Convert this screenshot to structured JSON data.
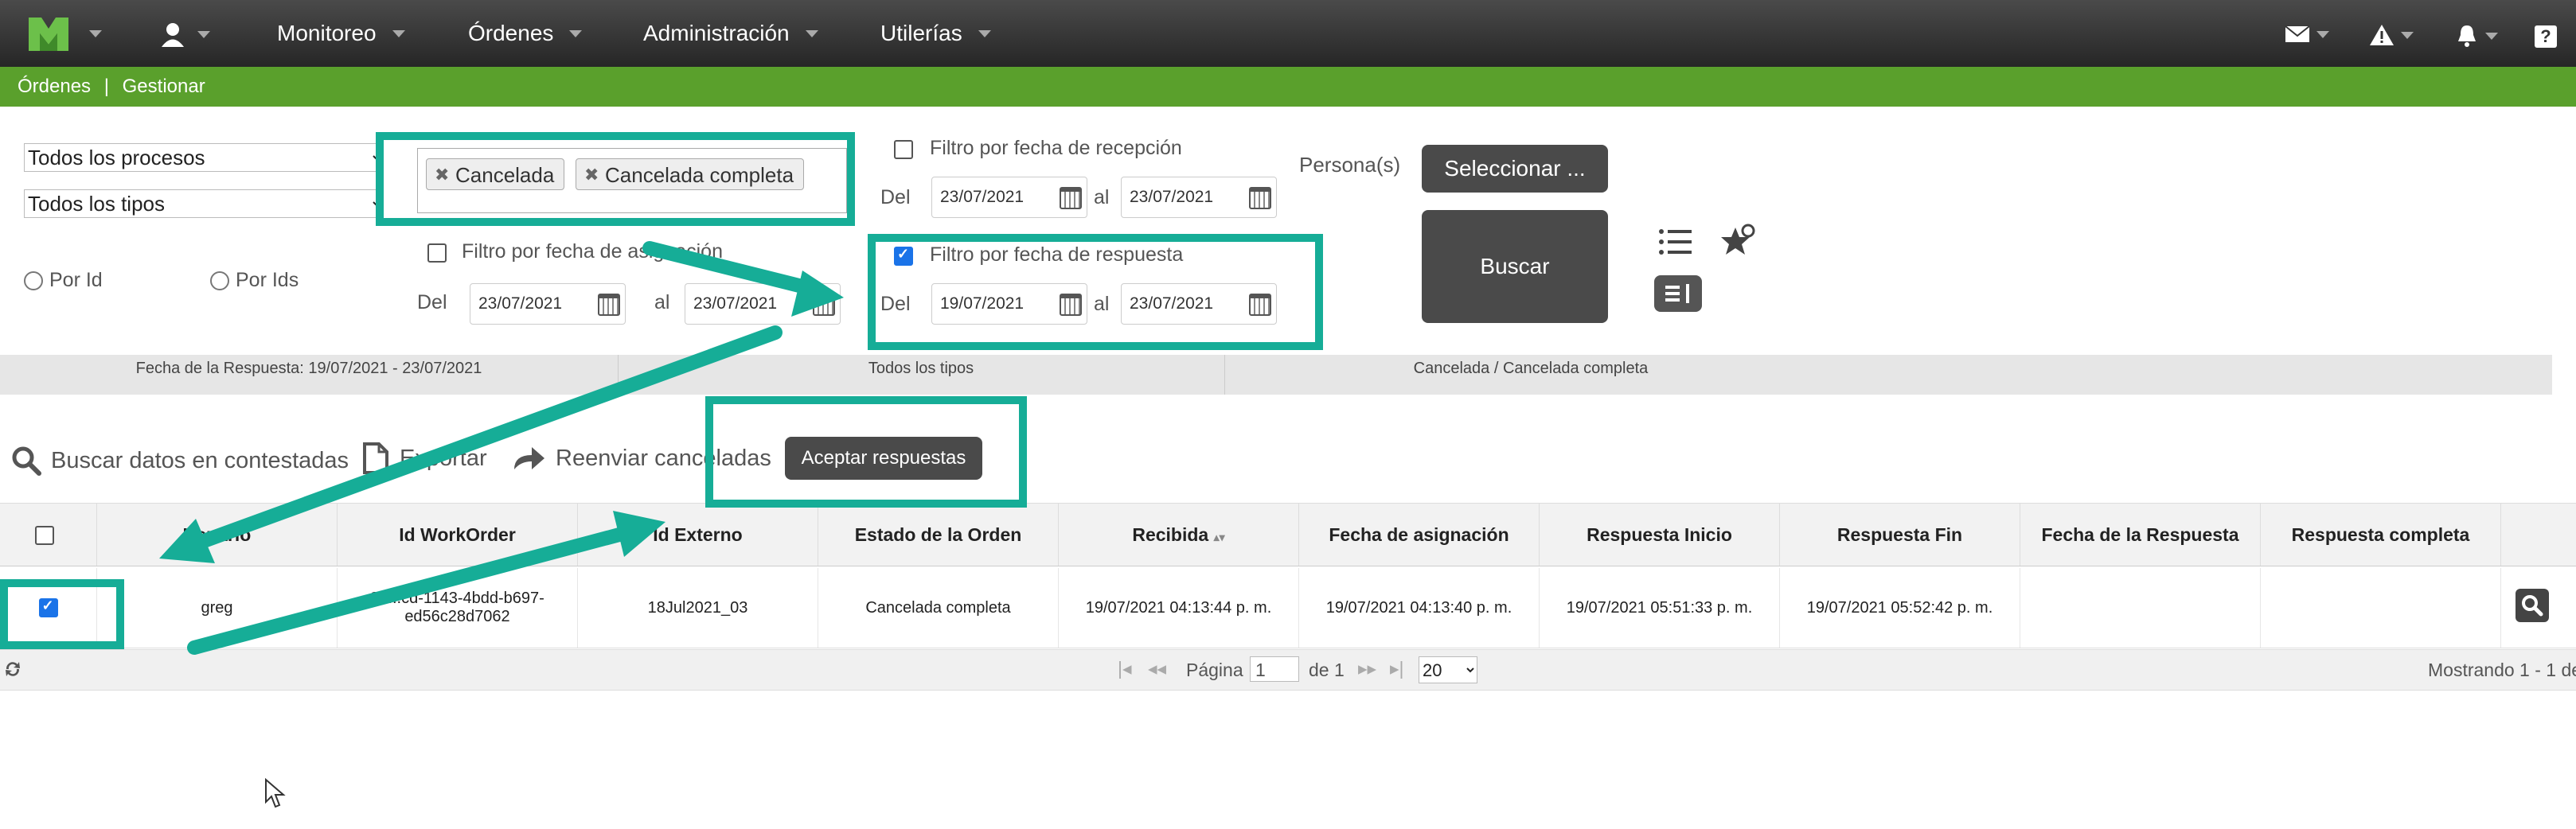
{
  "nav": {
    "menu": [
      "Monitoreo",
      "Órdenes",
      "Administración",
      "Utilerías"
    ],
    "help": "?"
  },
  "breadcrumb": {
    "section": "Órdenes",
    "separator": "|",
    "page": "Gestionar"
  },
  "filters": {
    "process_select": "Todos los procesos",
    "type_select": "Todos los tipos",
    "radio_by_id": "Por Id",
    "radio_by_ids": "Por Ids",
    "tags": [
      "Cancelada",
      "Cancelada completa"
    ],
    "assign_filter": {
      "label": "Filtro por fecha de asignación",
      "from_label": "Del",
      "from": "23/07/2021",
      "to_label": "al",
      "to": "23/07/2021",
      "checked": false
    },
    "reception_filter": {
      "label": "Filtro por fecha de recepción",
      "from_label": "Del",
      "from": "23/07/2021",
      "to_label": "al",
      "to": "23/07/2021",
      "checked": false
    },
    "response_filter": {
      "label": "Filtro por fecha de respuesta",
      "from_label": "Del",
      "from": "19/07/2021",
      "to_label": "al",
      "to": "23/07/2021",
      "checked": true
    },
    "persons_label": "Persona(s)",
    "select_button": "Seleccionar ...",
    "search_button": "Buscar"
  },
  "summary": [
    "Fecha de la Respuesta: 19/07/2021 - 23/07/2021",
    "Todos los tipos",
    "Cancelada / Cancelada completa"
  ],
  "toolbar": {
    "search_answered": "Buscar datos en contestadas",
    "export": "Exportar",
    "resend_cancelled": "Reenviar canceladas",
    "accept_responses": "Aceptar respuestas"
  },
  "table": {
    "columns": [
      "Usuario",
      "Id WorkOrder",
      "Id Externo",
      "Estado de la Orden",
      "Recibida",
      "Fecha de asignación",
      "Respuesta Inicio",
      "Respuesta Fin",
      "Fecha de la Respuesta",
      "Respuesta completa"
    ],
    "rows": [
      {
        "user": "greg",
        "workorder_line1": "39...cd-1143-4bdd-b697-",
        "workorder_line2": "ed56c28d7062",
        "external": "18Jul2021_03",
        "status": "Cancelada completa",
        "received": "19/07/2021 04:13:44 p. m.",
        "assigned": "19/07/2021 04:13:40 p. m.",
        "resp_start": "19/07/2021 05:51:33 p. m.",
        "resp_end": "19/07/2021 05:52:42 p. m.",
        "resp_date": "",
        "resp_complete": "",
        "checked": true
      }
    ]
  },
  "pager": {
    "page_label": "Página",
    "page": "1",
    "of_label": "de 1",
    "page_size": "20",
    "showing": "Mostrando 1 - 1 de"
  },
  "colors": {
    "accent_green": "#5aa02c",
    "teal_highlight": "#16ad97",
    "dark_button": "#4a4a4a"
  }
}
